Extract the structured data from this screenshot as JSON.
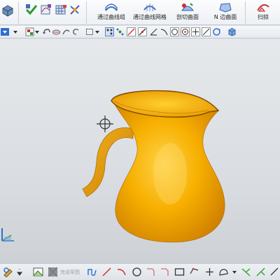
{
  "ribbon": {
    "buttons": [
      {
        "label": "通过曲线组",
        "icon": "through-curves-icon"
      },
      {
        "label": "通过曲线网格",
        "icon": "through-curve-mesh-icon"
      },
      {
        "label": "剖切曲面",
        "icon": "section-surface-icon"
      },
      {
        "label": "N 边曲面",
        "icon": "n-sided-surface-icon"
      },
      {
        "label": "扫掠",
        "icon": "swept-icon"
      }
    ]
  },
  "viewport": {
    "model": "pitcher",
    "model_color": "#f5a300"
  },
  "bottombar": {
    "finish_sketch_label": "完成草图"
  },
  "colors": {
    "accent": "#2e6fcf",
    "model": "#f5a300",
    "background": "#dfe3e8"
  }
}
